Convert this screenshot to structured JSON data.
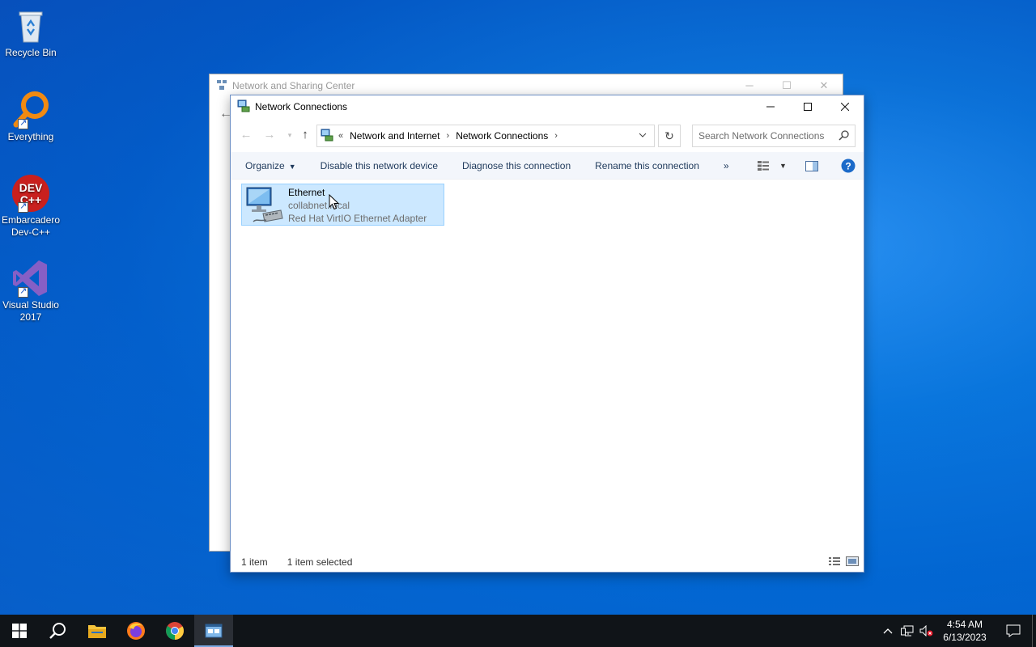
{
  "desktop": {
    "icons": [
      {
        "label": "Recycle Bin",
        "icon": "recycle-bin-icon"
      },
      {
        "label": "Everything",
        "icon": "everything-search-icon"
      },
      {
        "label": "Embarcadero Dev-C++",
        "icon": "devcpp-icon",
        "logo_text": "DEV C++"
      },
      {
        "label": "Visual Studio 2017",
        "icon": "visual-studio-icon"
      }
    ]
  },
  "back_window": {
    "title": "Network and Sharing Center"
  },
  "window": {
    "title": "Network Connections",
    "address": {
      "crumbs": [
        "Network and Internet",
        "Network Connections"
      ],
      "overflow_marker": "«"
    },
    "search": {
      "placeholder": "Search Network Connections"
    },
    "commands": {
      "organize": "Organize",
      "disable": "Disable this network device",
      "diagnose": "Diagnose this connection",
      "rename": "Rename this connection",
      "more": "»"
    },
    "items": [
      {
        "name": "Ethernet",
        "network": "collabnet.local",
        "adapter": "Red Hat VirtIO Ethernet Adapter",
        "selected": true
      }
    ],
    "status": {
      "count": "1 item",
      "selected": "1 item selected"
    }
  },
  "taskbar": {
    "clock_time": "4:54 AM",
    "clock_date": "6/13/2023"
  },
  "colors": {
    "selection_bg": "#cce8ff",
    "selection_border": "#99d1ff",
    "command_text": "#1e395b",
    "taskbar": "#101418"
  }
}
